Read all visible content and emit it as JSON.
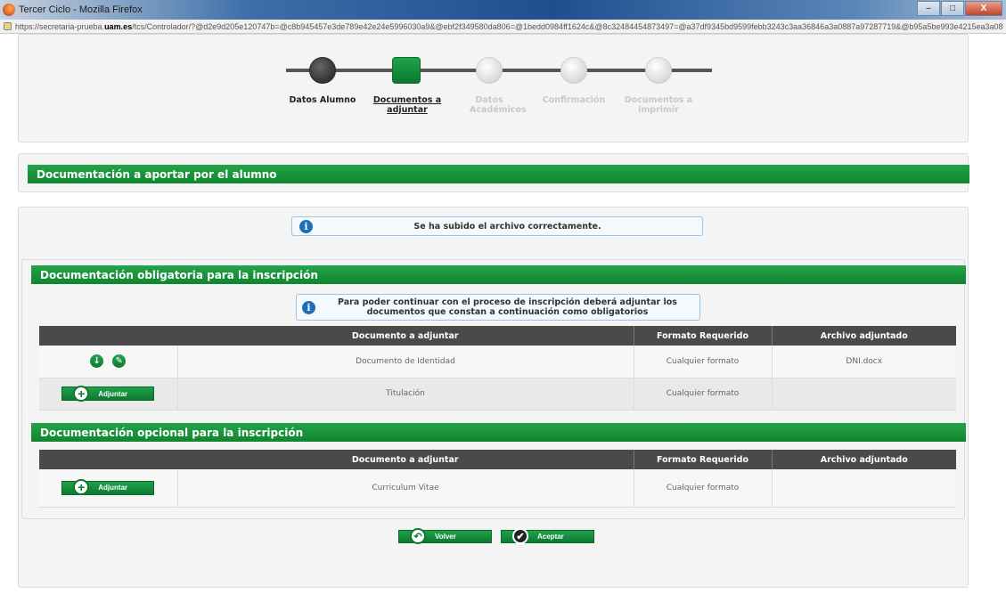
{
  "window": {
    "title": "Tercer Ciclo - Mozilla Firefox",
    "controls": [
      "–",
      "□",
      "X"
    ]
  },
  "address_bar": {
    "url_prefix": "https://secretaria-prueba.",
    "url_host": "uam.es",
    "url_rest": "/tcs/Controlador/?@d2e9d205e120747b=@c8b945457e3de789e42e24e5996030a9&@ebf2f349580da806=@1bedd0984ff1624c&@8c32484454873497=@a37df9345bd9599febb3243c3aa36846a3a0887a97287719&@b95a5be993e4215ea3a08"
  },
  "stepper": {
    "steps": [
      {
        "label": "Datos Alumno",
        "state": "done"
      },
      {
        "label": "Documentos a adjuntar",
        "state": "current"
      },
      {
        "label": "Datos Académicos",
        "state": "pending"
      },
      {
        "label": "Confirmación",
        "state": "pending"
      },
      {
        "label": "Documentos a imprimir",
        "state": "pending"
      }
    ]
  },
  "section_main": {
    "title": "Documentación a aportar por el alumno"
  },
  "upload_message": {
    "icon": "info-icon",
    "text": "Se ha subido el archivo correctamente."
  },
  "mandatory": {
    "title": "Documentación obligatoria para la inscripción",
    "notice": "Para poder continuar con el proceso de inscripción deberá adjuntar los documentos que constan a continuación como obligatorios",
    "columns": [
      "",
      "Documento a adjuntar",
      "Formato Requerido",
      "Archivo adjuntado"
    ],
    "rows": [
      {
        "document": "Documento de Identidad",
        "format": "Cualquier formato",
        "file": "DNI.docx",
        "actions": [
          "download-icon",
          "edit-icon"
        ]
      },
      {
        "document": "Titulación",
        "format": "Cualquier formato",
        "file": "",
        "button": "Adjuntar"
      }
    ]
  },
  "optional": {
    "title": "Documentación opcional para la inscripción",
    "columns": [
      "",
      "Documento a adjuntar",
      "Formato Requerido",
      "Archivo adjuntado"
    ],
    "rows": [
      {
        "document": "Curriculum Vitae",
        "format": "Cualquier formato",
        "file": "",
        "button": "Adjuntar"
      }
    ]
  },
  "footer_buttons": {
    "back": "Volver",
    "accept": "Aceptar"
  },
  "colors": {
    "green": "#10852f",
    "table_header": "#4a4a4a",
    "info_border": "#9dc3e6"
  }
}
